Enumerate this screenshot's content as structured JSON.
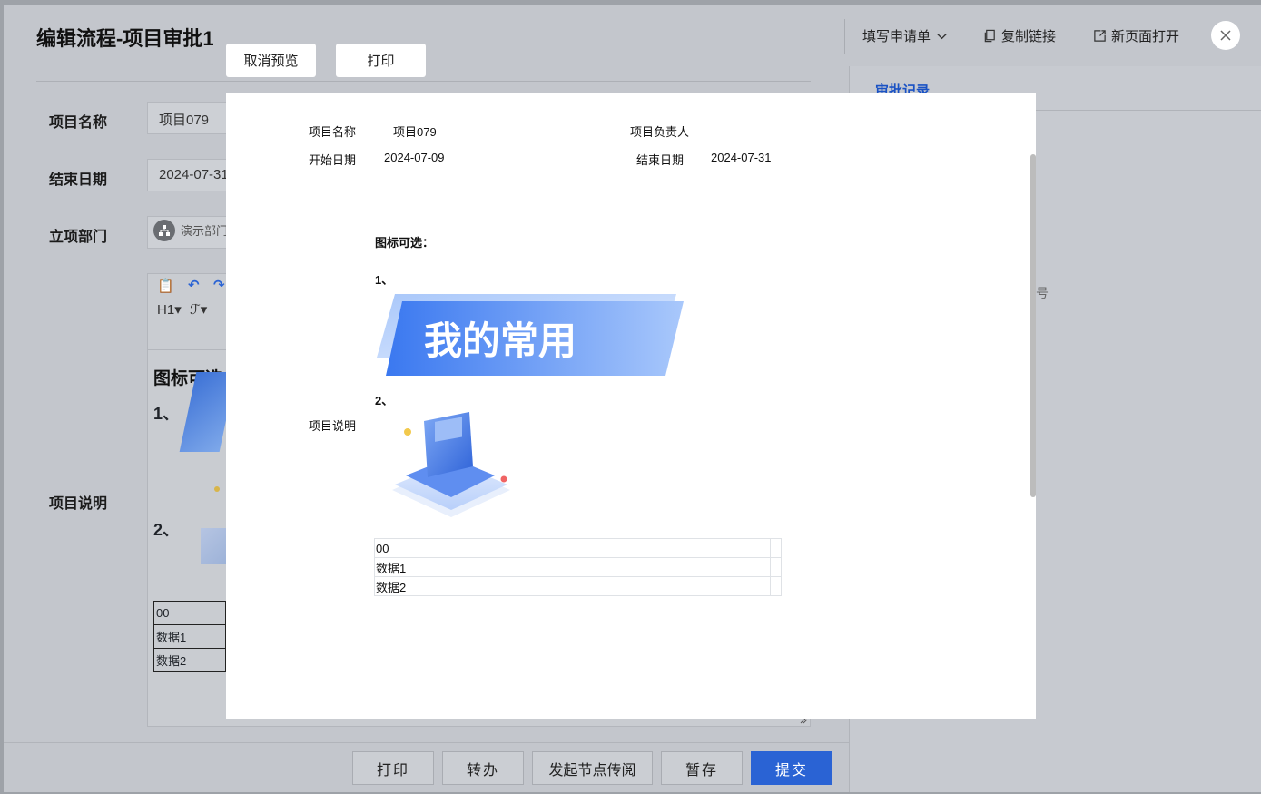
{
  "header": {
    "title": "编辑流程-项目审批1",
    "fill_request": "填写申请单",
    "copy_link": "复制链接",
    "open_new_page": "新页面打开"
  },
  "form": {
    "project_name_label": "项目名称",
    "project_name_value": "项目079",
    "end_date_label": "结束日期",
    "end_date_value": "2024-07-31",
    "dept_label": "立项部门",
    "dept_value": "演示部门",
    "desc_label": "项目说明"
  },
  "editor": {
    "heading": "图标可选：",
    "item1": "1、",
    "item2": "2、",
    "table": [
      "00",
      "数据1",
      "数据2"
    ],
    "toolbar_h1": "H1",
    "toolbar_font": "ℱ"
  },
  "right_panel": {
    "tab": "审批记录",
    "hint": "号"
  },
  "bottom_bar": {
    "print": "打印",
    "transfer": "转办",
    "circulate": "发起节点传阅",
    "save_draft": "暂存",
    "submit": "提交"
  },
  "preview": {
    "cancel_preview": "取消预览",
    "print": "打印",
    "project_name_label": "项目名称",
    "project_name_value": "项目079",
    "owner_label": "项目负责人",
    "start_date_label": "开始日期",
    "start_date_value": "2024-07-09",
    "end_date_label": "结束日期",
    "end_date_value": "2024-07-31",
    "desc_label": "项目说明",
    "heading": "图标可选：",
    "item1": "1、",
    "item2": "2、",
    "banner_text": "我的常用",
    "table": [
      "00",
      "数据1",
      "数据2"
    ]
  },
  "colors": {
    "primary": "#2a63d4",
    "link": "#1a52c4",
    "banner_start": "#3a78f0",
    "banner_end": "#a9c8fb"
  }
}
